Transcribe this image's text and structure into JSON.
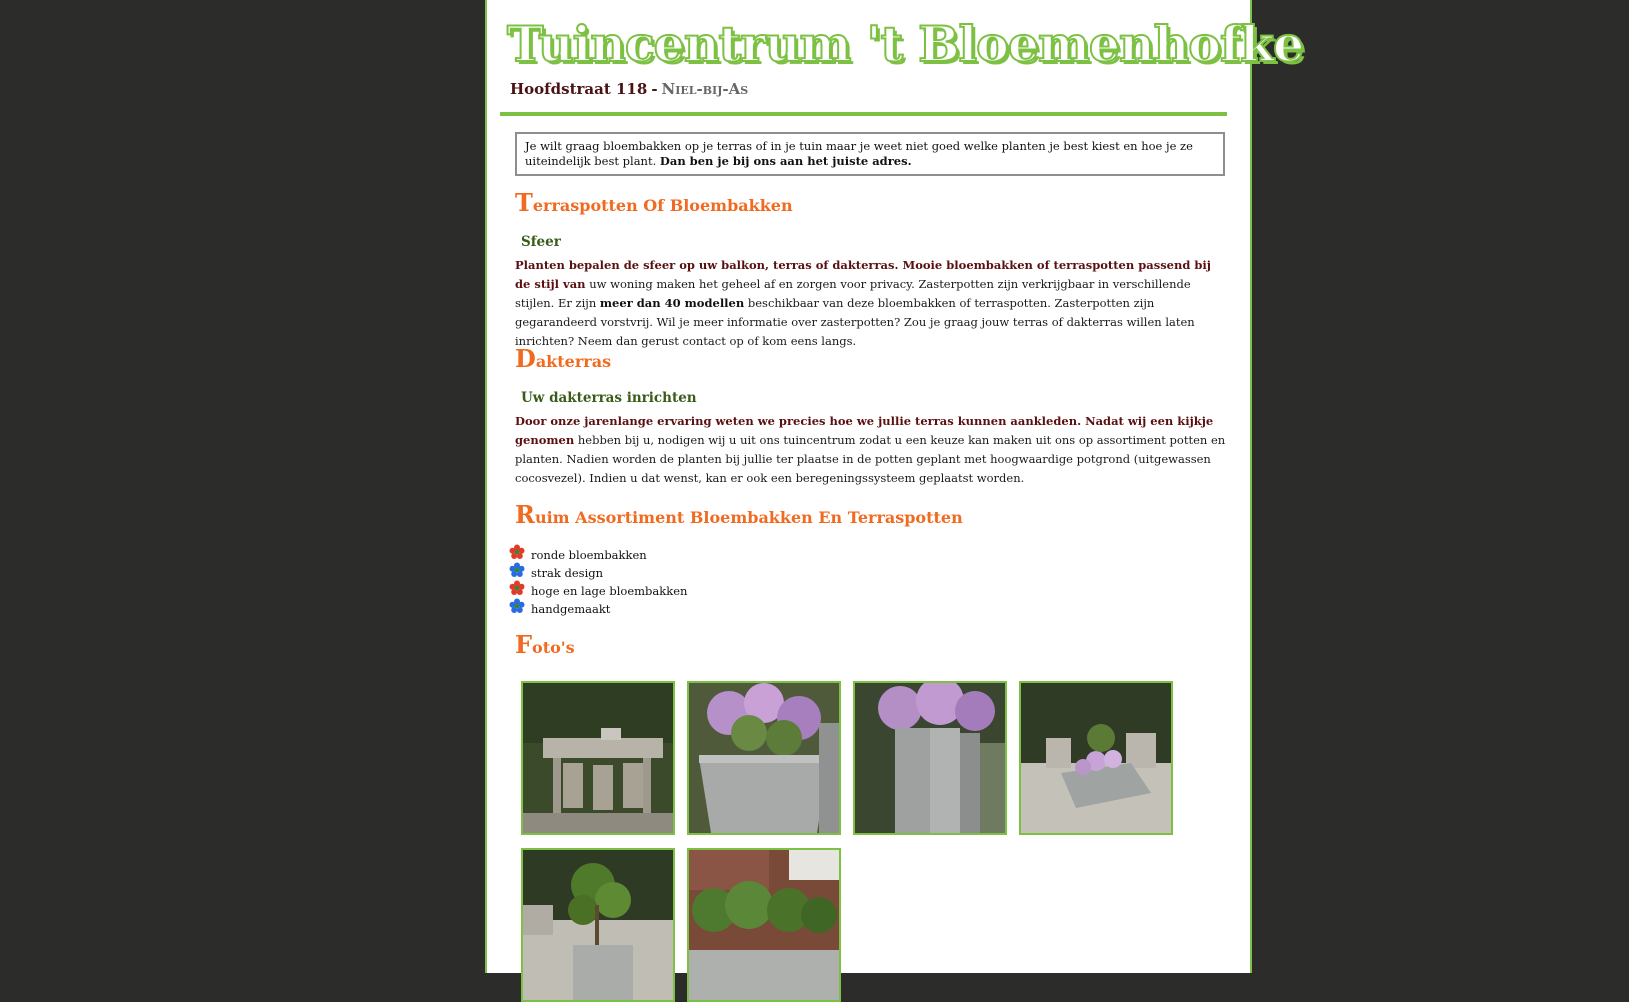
{
  "site": {
    "title": "Tuincentrum 't Bloemenhofke",
    "address_street": "Hoofdstraat 118",
    "address_separator": "-",
    "address_city": "Niel-bij-As"
  },
  "intro": {
    "text": "Je wilt graag bloembakken op je terras of in je tuin maar je weet niet goed welke planten je best kiest en hoe je ze uiteindelijk best plant. ",
    "strong": "Dan ben je bij ons aan het juiste adres."
  },
  "sections": [
    {
      "heading_cap": "T",
      "heading_rest": "erraspotten Of Bloembakken",
      "subheading": "Sfeer",
      "lead": "Planten bepalen de sfeer op uw balkon, terras of dakterras. Mooie bloembakken of terraspotten passend bij de stijl van",
      "text_1": " uw woning maken het geheel af en zorgen voor privacy. Zasterpotten zijn verkrijgbaar in verschillende stijlen. Er zijn ",
      "strong": "meer dan 40 modellen",
      "text_2": " beschikbaar van deze bloembakken of terraspotten. Zasterpotten zijn gegarandeerd vorstvrij. Wil je meer informatie over zasterpotten? Zou je graag jouw terras of dakterras willen laten inrichten? Neem dan gerust contact op of kom eens langs."
    },
    {
      "heading_cap": "D",
      "heading_rest": "akterras",
      "subheading": "Uw dakterras inrichten",
      "lead": "Door onze jarenlange ervaring weten we precies hoe we jullie terras kunnen aankleden. Nadat wij een kijkje genomen",
      "text_1": " hebben bij u, nodigen wij u uit ons tuincentrum zodat u een keuze kan maken uit ons op assortiment potten en planten. Nadien worden de planten bij jullie ter plaatse in de potten geplant met hoogwaardige potgrond (uitgewassen cocosvezel). Indien u dat wenst, kan er ook een beregeningssysteem geplaatst worden."
    }
  ],
  "assortment": {
    "heading_cap": "R",
    "heading_rest": "uim Assortiment Bloembakken En Terraspotten",
    "items": [
      {
        "label": "ronde bloembakken",
        "icon": "red-flower-icon",
        "color": "#e23a2a"
      },
      {
        "label": "strak design",
        "icon": "blue-flower-icon",
        "color": "#2a6ae2"
      },
      {
        "label": "hoge en lage bloembakken",
        "icon": "red-flower-icon",
        "color": "#e23a2a"
      },
      {
        "label": "handgemaakt",
        "icon": "blue-flower-icon",
        "color": "#2a6ae2"
      }
    ]
  },
  "photos": {
    "heading_cap": "F",
    "heading_rest": "oto's",
    "count": 6
  },
  "colors": {
    "background": "#2c2c2a",
    "accent_green": "#7cc143",
    "heading_orange": "#f06a1f",
    "subheading_green": "#3a5c1b",
    "lead_maroon": "#5a1010"
  }
}
